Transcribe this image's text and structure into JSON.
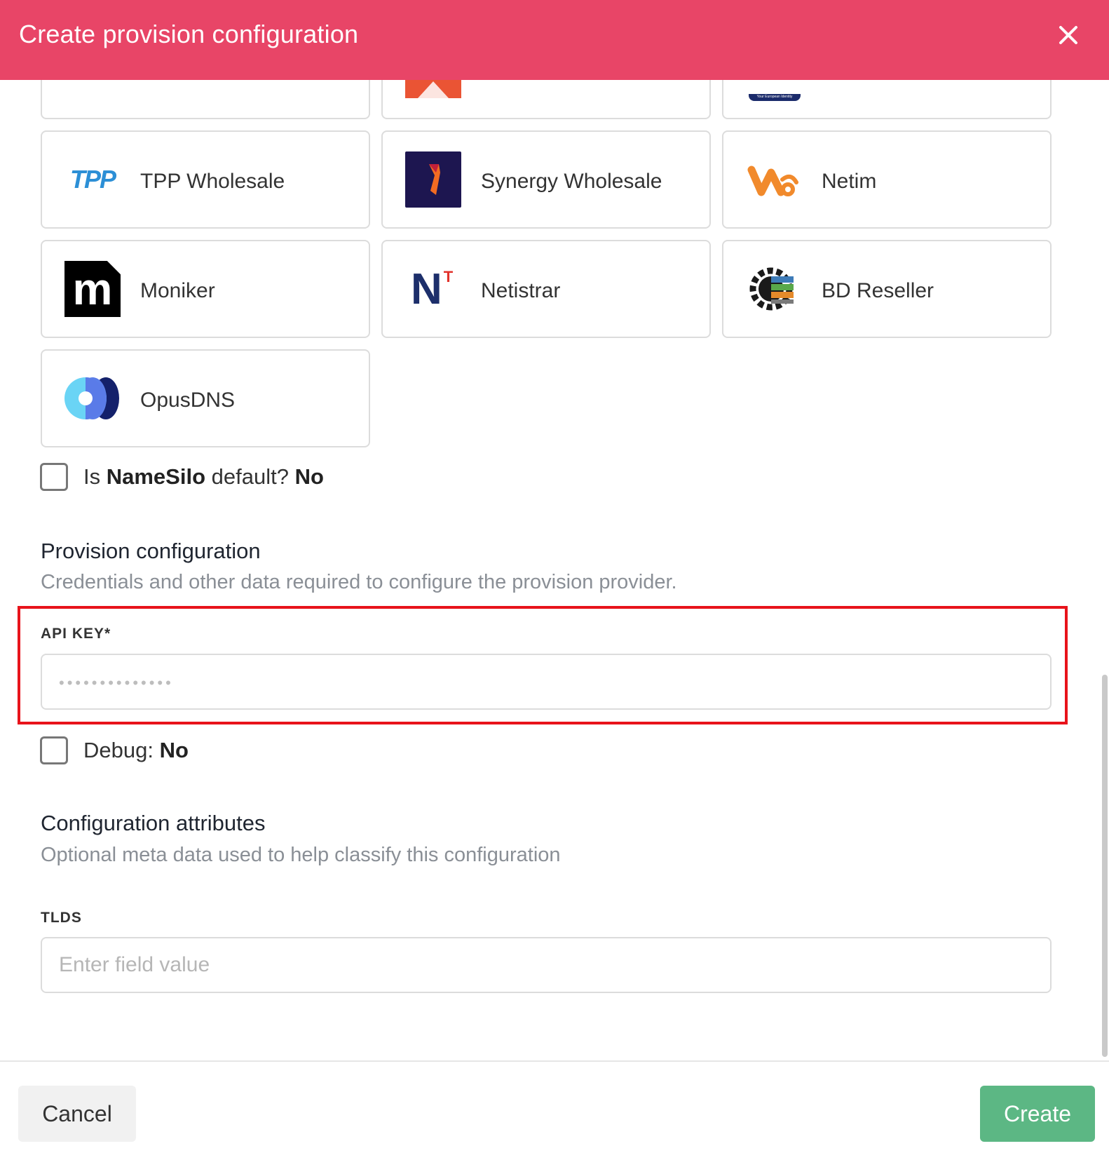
{
  "header": {
    "title": "Create provision configuration",
    "close_icon": "close-icon"
  },
  "providers": [
    {
      "name": "TPP Wholesale",
      "icon": "tpp-logo-icon"
    },
    {
      "name": "Synergy Wholesale",
      "icon": "synergy-logo-icon"
    },
    {
      "name": "Netim",
      "icon": "netim-logo-icon"
    },
    {
      "name": "Moniker",
      "icon": "moniker-logo-icon"
    },
    {
      "name": "Netistrar",
      "icon": "netistrar-logo-icon"
    },
    {
      "name": "BD Reseller",
      "icon": "bd-reseller-logo-icon"
    },
    {
      "name": "OpusDNS",
      "icon": "opusdns-logo-icon"
    }
  ],
  "partial_logo_text": {
    "tpp": "TPP",
    "moniker": "m",
    "netistrar_n": "N",
    "netistrar_t": "T",
    "eurid": "Your European Identity"
  },
  "default_check": {
    "prefix": "Is ",
    "provider": "NameSilo",
    "middle": " default? ",
    "value": "No"
  },
  "provision": {
    "title": "Provision configuration",
    "description": "Credentials and other data required to configure the provision provider.",
    "api_key_label": "API KEY*",
    "api_key_placeholder": "••••••••••••••"
  },
  "debug_check": {
    "prefix": "Debug: ",
    "value": "No"
  },
  "attributes": {
    "title": "Configuration attributes",
    "description": "Optional meta data used to help classify this configuration",
    "tlds_label": "TLDS",
    "tlds_placeholder": "Enter field value"
  },
  "footer": {
    "cancel_label": "Cancel",
    "create_label": "Create"
  },
  "colors": {
    "header": "#e84567",
    "create_button": "#5cb784",
    "highlight": "#e8131b"
  }
}
